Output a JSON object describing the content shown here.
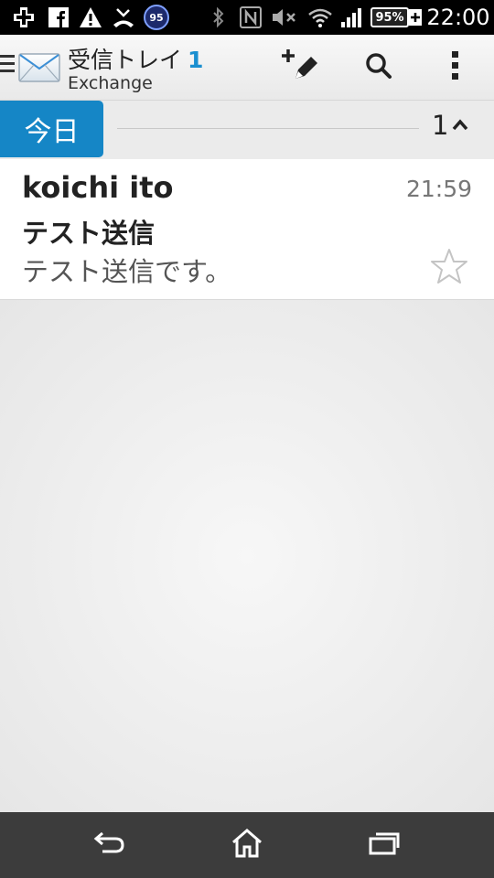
{
  "status_bar": {
    "notification_badge": "95",
    "battery_percent": "95%",
    "time": "22:00",
    "icons": [
      "add-icon",
      "facebook-icon",
      "warning-icon",
      "missed-call-icon",
      "notification-badge",
      "bluetooth-icon",
      "nfc-icon",
      "mute-icon",
      "wifi-icon",
      "signal-icon",
      "battery-icon",
      "charging-icon"
    ]
  },
  "action_bar": {
    "title": "受信トレイ",
    "unread_count": "1",
    "subtitle": "Exchange",
    "buttons": [
      "compose-button",
      "search-button",
      "overflow-menu-button"
    ]
  },
  "section": {
    "label": "今日",
    "count": "1"
  },
  "messages": [
    {
      "sender": "koichi ito",
      "time": "21:59",
      "subject": "テスト送信",
      "preview": "テスト送信です。",
      "starred": false
    }
  ],
  "nav_bar": {
    "buttons": [
      "back-button",
      "home-button",
      "recent-apps-button"
    ]
  },
  "colors": {
    "accent": "#1586c6",
    "unread_count": "#1a8fd0",
    "status_bar": "#000000",
    "nav_bar": "#3c3c3c"
  }
}
